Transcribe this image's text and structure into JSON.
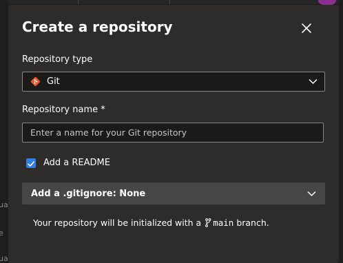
{
  "modal": {
    "title": "Create a repository",
    "close_icon": "close-icon",
    "repository_type": {
      "label": "Repository type",
      "selected": "Git",
      "icon": "git-icon",
      "icon_color": "#e8562e"
    },
    "repository_name": {
      "label": "Repository name *",
      "value": "",
      "placeholder": "Enter a name for your Git repository"
    },
    "readme": {
      "label": "Add a README",
      "checked": true,
      "checkbox_color": "#2f7fe0"
    },
    "gitignore": {
      "label": "Add a .gitignore: None"
    },
    "info": {
      "prefix": "Your repository will be initialized with a",
      "branch": "main",
      "suffix": "branch."
    }
  },
  "background": {
    "fragments": [
      "ual",
      "e",
      "ual"
    ]
  }
}
